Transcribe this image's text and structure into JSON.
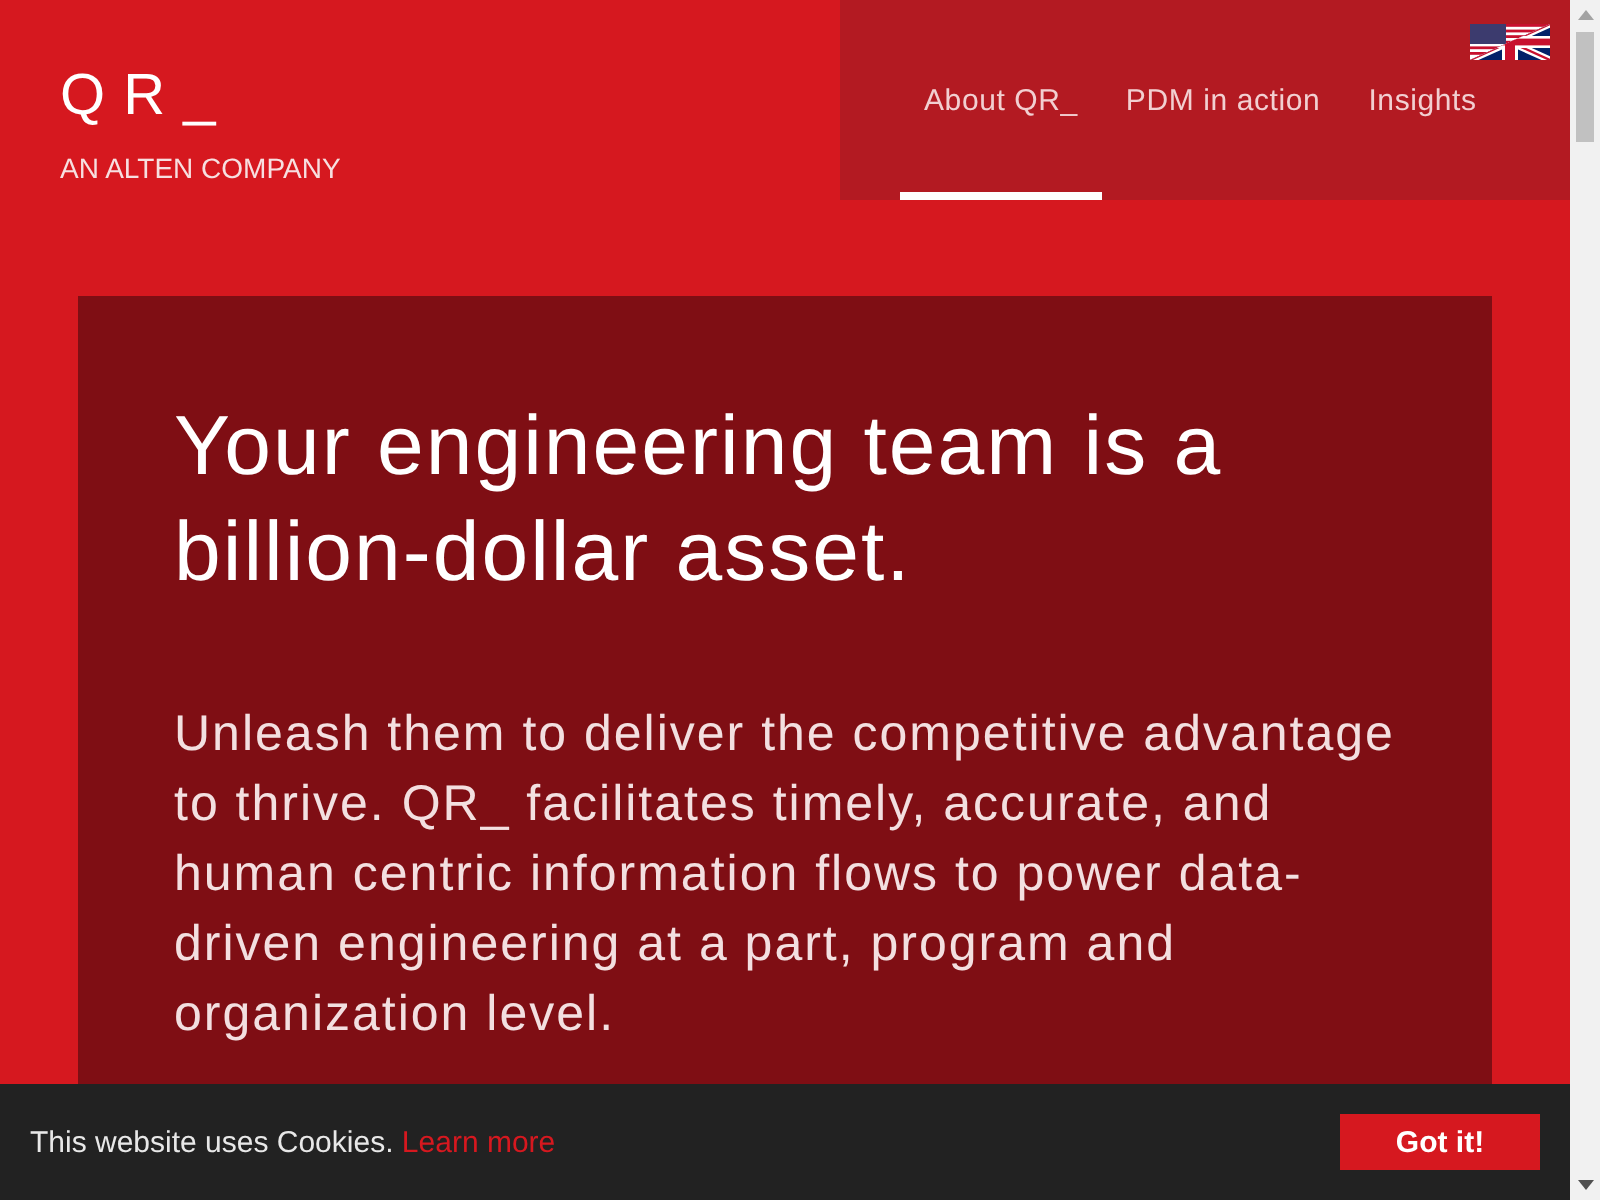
{
  "logo": {
    "text": "Q R _",
    "tagline": "AN ALTEN COMPANY"
  },
  "nav": {
    "items": [
      {
        "label": "About QR_",
        "selected": true
      },
      {
        "label": "PDM in action",
        "selected": false
      },
      {
        "label": "Insights",
        "selected": false
      }
    ]
  },
  "hero": {
    "heading": "Your engineering team is a billion-dollar asset.",
    "body": "Unleash them to deliver the competitive advantage to thrive. QR_ facilitates timely, accurate, and human centric information flows to power data-driven engineering at a part, program and organization level."
  },
  "cookie_banner": {
    "message": "This website uses Cookies.",
    "link": "Learn more",
    "button": "Got it!"
  }
}
